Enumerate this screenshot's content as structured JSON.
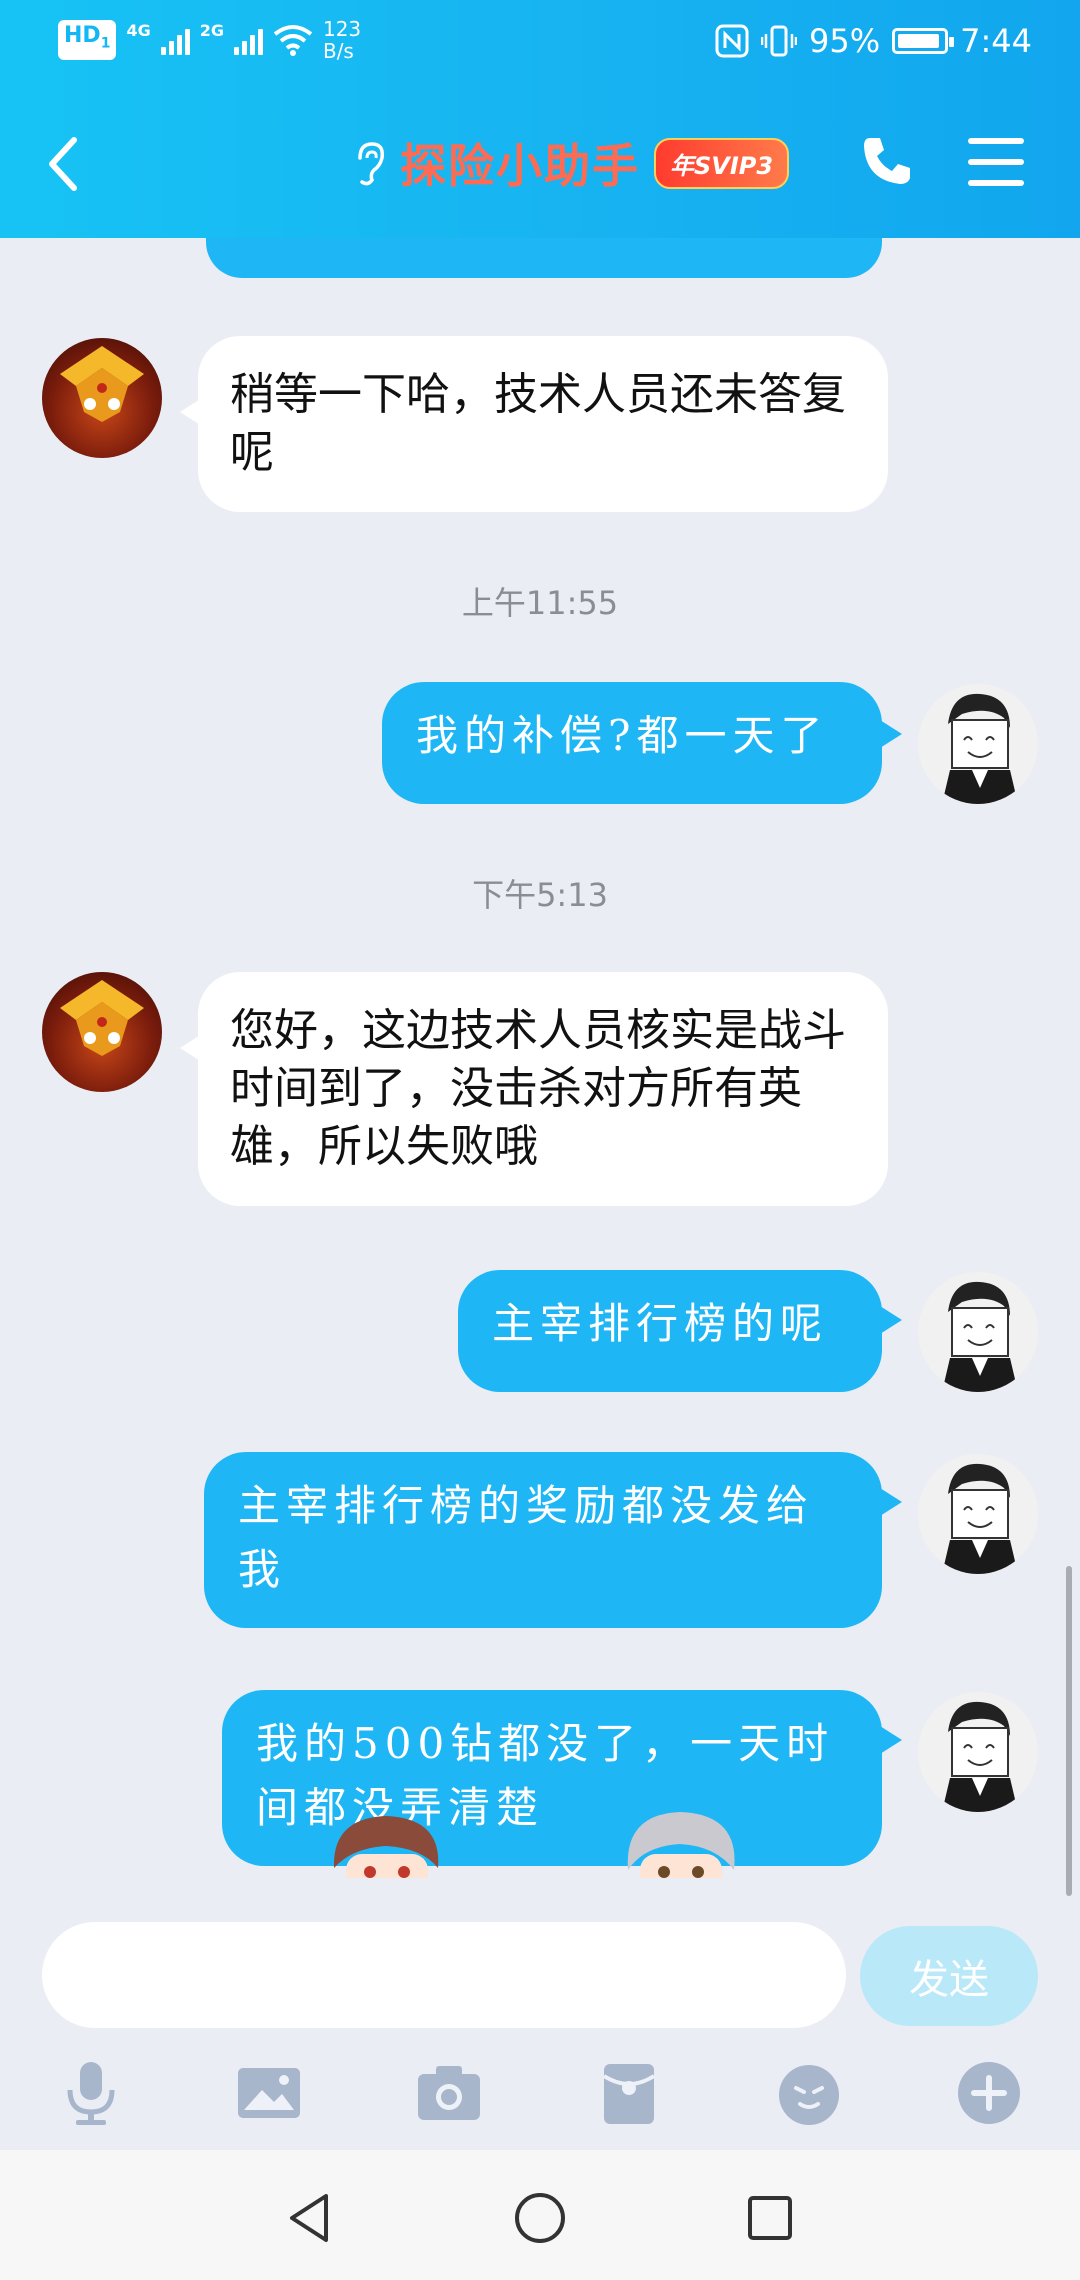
{
  "status_bar": {
    "hd": "HD",
    "hd_sub": "1",
    "net1": "4G",
    "net2": "2G",
    "speed_value": "123",
    "speed_unit": "B/s",
    "battery": "95%",
    "time": "7:44"
  },
  "header": {
    "title": "探险小助手",
    "badge": "年SVIP3"
  },
  "messages": [
    {
      "side": "left",
      "text": "稍等一下哈，技术人员还未答复呢"
    },
    {
      "timestamp": "上午11:55"
    },
    {
      "side": "right",
      "text": "我的补偿?都一天了"
    },
    {
      "timestamp": "下午5:13"
    },
    {
      "side": "left",
      "text": "您好，这边技术人员核实是战斗时间到了，没击杀对方所有英雄，所以失败哦"
    },
    {
      "side": "right",
      "text": "主宰排行榜的呢"
    },
    {
      "side": "right",
      "text": "主宰排行榜的奖励都没发给我"
    },
    {
      "side": "right",
      "text": "我的500钻都没了，一天时间都没弄清楚"
    }
  ],
  "composer": {
    "placeholder": "",
    "send_label": "发送"
  },
  "toolbar_icons": [
    "microphone-icon",
    "image-icon",
    "camera-icon",
    "red-packet-icon",
    "emoji-icon",
    "plus-icon"
  ],
  "nav_icons": [
    "back-triangle-icon",
    "home-circle-icon",
    "recents-square-icon"
  ],
  "colors": {
    "header": "#17b3f1",
    "bubble_self": "#1fb6f5",
    "bubble_other": "#ffffff",
    "chat_bg": "#eaedf4",
    "title": "#ff6b52",
    "send_disabled": "#b9e8f9"
  }
}
